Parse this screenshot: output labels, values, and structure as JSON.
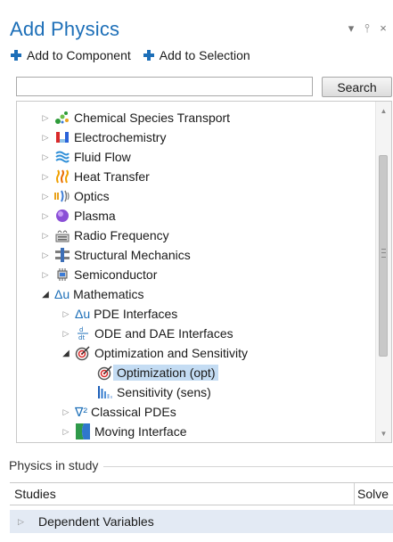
{
  "panel": {
    "title": "Add Physics"
  },
  "window_controls": [
    "chevron-down-icon",
    "pin-icon",
    "close-icon"
  ],
  "toolbar": {
    "add_component_label": "Add to Component",
    "add_selection_label": "Add to Selection"
  },
  "search": {
    "value": "",
    "placeholder": "",
    "button_label": "Search"
  },
  "tree": {
    "items": [
      {
        "label": "Chemical Species Transport",
        "icon": "chemical-species-icon",
        "expanded": false
      },
      {
        "label": "Electrochemistry",
        "icon": "electrochemistry-icon",
        "expanded": false
      },
      {
        "label": "Fluid Flow",
        "icon": "fluid-flow-icon",
        "expanded": false
      },
      {
        "label": "Heat Transfer",
        "icon": "heat-transfer-icon",
        "expanded": false
      },
      {
        "label": "Optics",
        "icon": "optics-icon",
        "expanded": false
      },
      {
        "label": "Plasma",
        "icon": "plasma-icon",
        "expanded": false
      },
      {
        "label": "Radio Frequency",
        "icon": "radio-frequency-icon",
        "expanded": false
      },
      {
        "label": "Structural Mechanics",
        "icon": "structural-mechanics-icon",
        "expanded": false
      },
      {
        "label": "Semiconductor",
        "icon": "semiconductor-icon",
        "expanded": false
      },
      {
        "label": "Mathematics",
        "icon": "mathematics-icon",
        "icon_text": "Δu",
        "expanded": true
      },
      {
        "label": "PDE Interfaces",
        "icon": "pde-interfaces-icon",
        "icon_text": "Δu",
        "expanded": false
      },
      {
        "label": "ODE and DAE Interfaces",
        "icon": "ode-dae-icon",
        "expanded": false
      },
      {
        "label": "Optimization and Sensitivity",
        "icon": "optimization-icon",
        "expanded": true
      },
      {
        "label": "Optimization (opt)",
        "icon": "optimization-icon",
        "selected": true
      },
      {
        "label": "Sensitivity (sens)",
        "icon": "sensitivity-icon"
      },
      {
        "label": "Classical PDEs",
        "icon": "classical-pdes-icon",
        "icon_text": "∇²",
        "expanded": false
      },
      {
        "label": "Moving Interface",
        "icon": "moving-interface-icon",
        "expanded": false
      }
    ]
  },
  "study_section": {
    "title": "Physics in study",
    "columns": [
      "Studies",
      "Solve"
    ],
    "row_label": "Dependent Variables"
  },
  "colors": {
    "accent": "#1d6fb8",
    "selection": "#c4dcf3",
    "row_highlight": "#e3eaf4"
  }
}
